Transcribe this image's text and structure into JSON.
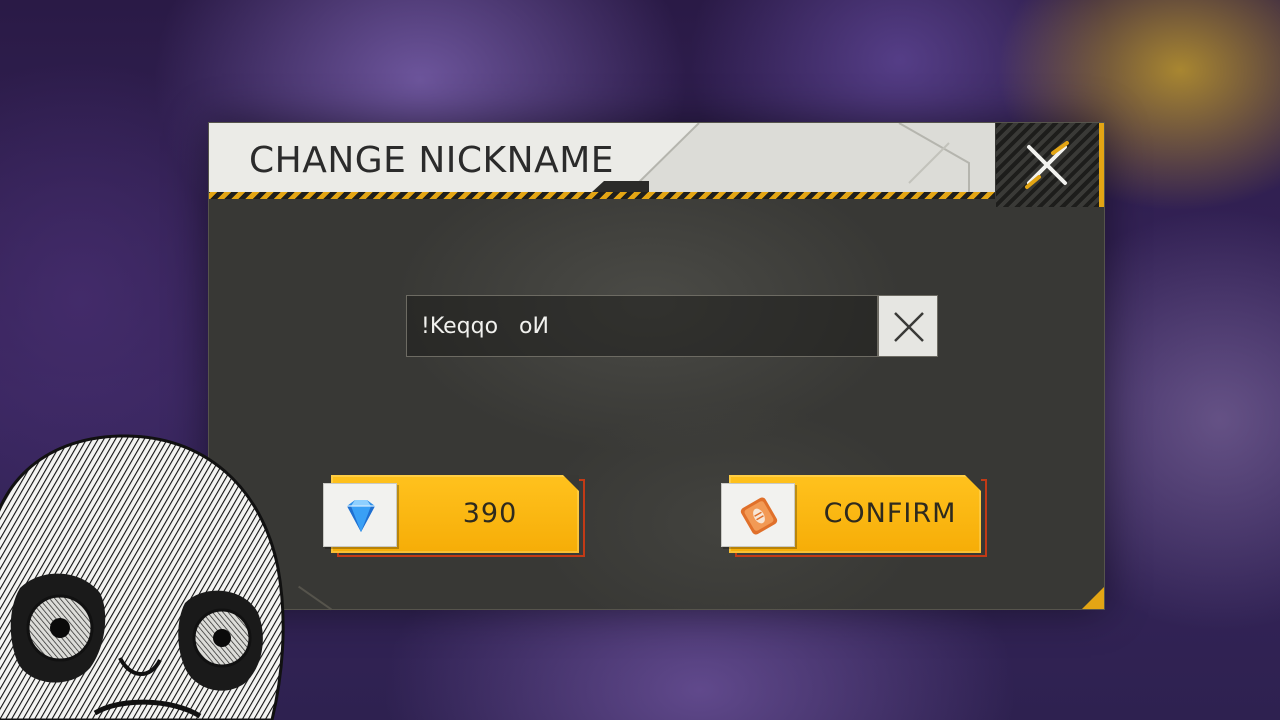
{
  "dialog": {
    "title": "CHANGE NICKNAME",
    "close_icon": "close-x-icon"
  },
  "nickname": {
    "value": "!Keqqo   oИ",
    "clear_icon": "clear-x-icon"
  },
  "actions": {
    "price": {
      "icon": "diamond-icon",
      "label": "390"
    },
    "confirm": {
      "icon": "name-change-card-icon",
      "label": "CONFIRM"
    }
  },
  "colors": {
    "accent_yellow": "#f6ad07",
    "hazard_dark": "#1f1f1d",
    "panel": "#383835",
    "diamond_blue": "#2f8fe8",
    "card_orange": "#e0702a"
  },
  "overlay": {
    "icon": "scared-face-meme"
  }
}
